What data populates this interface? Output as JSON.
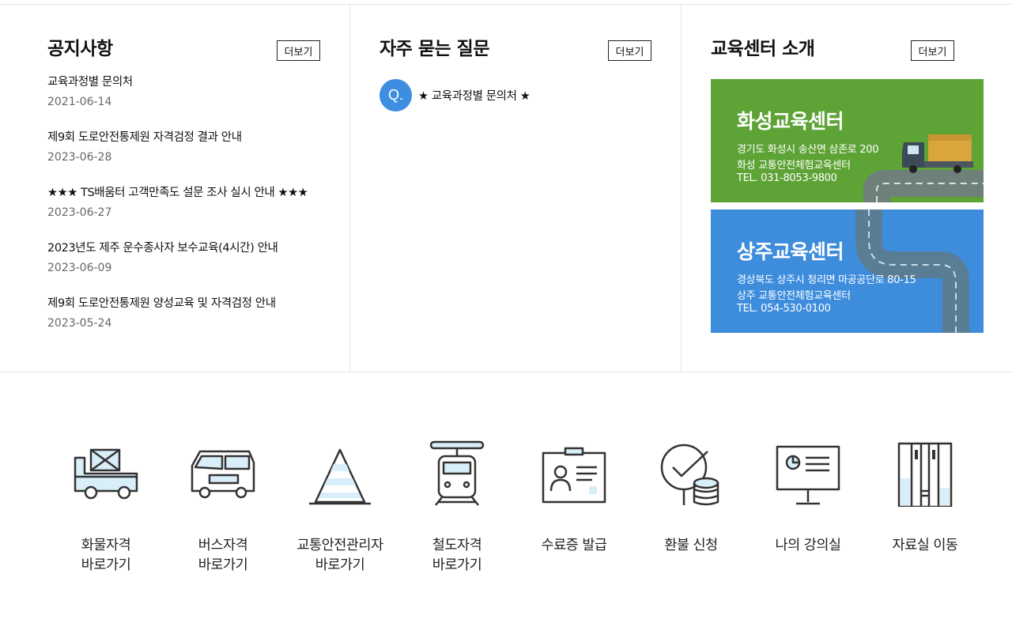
{
  "notice": {
    "title": "공지사항",
    "more_label": "더보기",
    "items": [
      {
        "title": "교육과정별 문의처",
        "date": "2021-06-14"
      },
      {
        "title": "제9회 도로안전통제원 자격검정 결과 안내",
        "date": "2023-06-28"
      },
      {
        "title": "★★★ TS배움터 고객만족도 설문 조사 실시 안내 ★★★",
        "date": "2023-06-27"
      },
      {
        "title": "2023년도 제주 운수종사자 보수교육(4시간) 안내",
        "date": "2023-06-09"
      },
      {
        "title": "제9회 도로안전통제원 양성교육 및 자격검정 안내",
        "date": "2023-05-24"
      }
    ]
  },
  "faq": {
    "title": "자주 묻는 질문",
    "more_label": "더보기",
    "items": [
      {
        "badge": "Q.",
        "text": "★ 교육과정별 문의처 ★"
      }
    ]
  },
  "centers": {
    "title": "교육센터 소개",
    "more_label": "더보기",
    "colors": {
      "hwaseong": "#5ea336",
      "sangju": "#3e8ddd"
    },
    "items": [
      {
        "name": "화성교육센터",
        "address": "경기도 화성시 송산면 삼존로 200",
        "org": "화성 교통안전체험교육센터",
        "tel": "TEL. 031-8053-9800"
      },
      {
        "name": "상주교육센터",
        "address": "경상북도 상주시 청리면 마공공단로 80-15",
        "org": "상주 교통안전체험교육센터",
        "tel": "TEL. 054-530-0100"
      }
    ]
  },
  "quick_links": [
    {
      "icon": "cargo-truck-icon",
      "line1": "화물자격",
      "line2": "바로가기"
    },
    {
      "icon": "bus-icon",
      "line1": "버스자격",
      "line2": "바로가기"
    },
    {
      "icon": "traffic-cone-icon",
      "line1": "교통안전관리자",
      "line2": "바로가기"
    },
    {
      "icon": "train-icon",
      "line1": "철도자격",
      "line2": "바로가기"
    },
    {
      "icon": "certificate-card-icon",
      "line1": "수료증 발급",
      "line2": ""
    },
    {
      "icon": "refund-check-coins-icon",
      "line1": "환불 신청",
      "line2": ""
    },
    {
      "icon": "monitor-lecture-icon",
      "line1": "나의 강의실",
      "line2": ""
    },
    {
      "icon": "archive-bookshelf-icon",
      "line1": "자료실 이동",
      "line2": ""
    }
  ]
}
